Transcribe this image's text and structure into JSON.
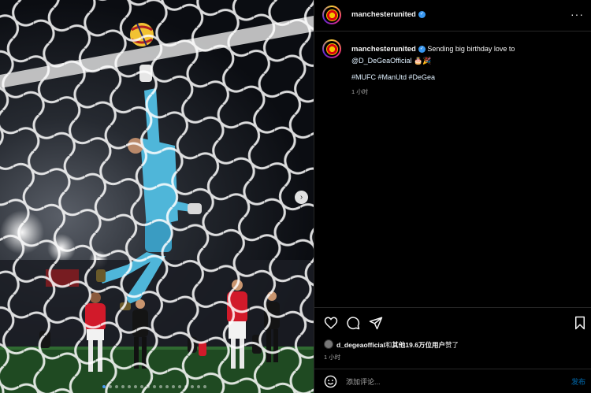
{
  "post": {
    "username": "manchesterunited",
    "caption_text": "Sending big birthday love to",
    "caption_mention": "@D_DeGeaOfficial",
    "caption_emoji": "🎂🎉",
    "hashtags": "#MUFC #ManUtd #DeGea",
    "time_ago": "1 小时"
  },
  "photo": {
    "alt": "Goalkeeper diving toward the ball inside the goal net at night",
    "next_icon": "chevron-right-icon",
    "carousel_total": 17,
    "carousel_active_index": 0
  },
  "actions": {
    "like_icon": "heart-icon",
    "comment_icon": "comment-icon",
    "share_icon": "send-icon",
    "save_icon": "bookmark-icon"
  },
  "likes": {
    "user": "d_degeaofficial",
    "connector": "和",
    "others": "其他19.6万位用户",
    "suffix": "赞了"
  },
  "footer": {
    "time_ago": "1 小时"
  },
  "comment": {
    "placeholder": "添加评论...",
    "post_label": "发布"
  },
  "colors": {
    "accent": "#0095f6",
    "verified": "#3897f0",
    "keeper_kit": "#4fb6d9",
    "home_kit": "#d11a2a"
  }
}
